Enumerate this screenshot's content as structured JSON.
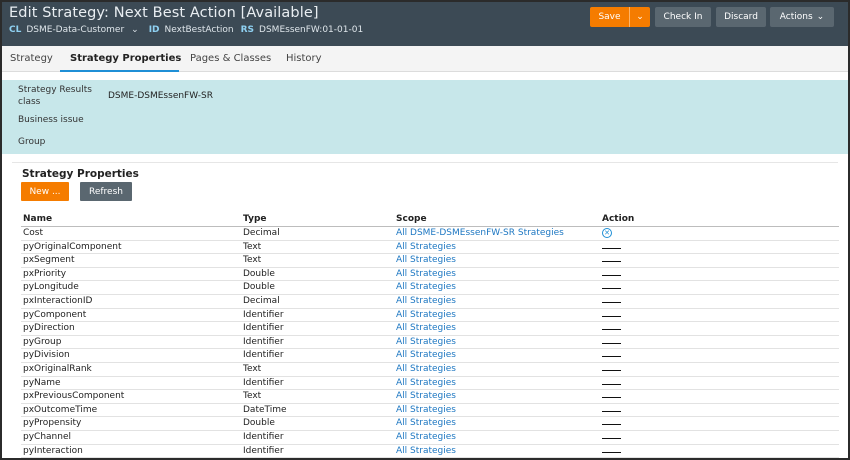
{
  "header": {
    "title": "Edit Strategy: Next Best Action [Available]",
    "cl_key": "CL",
    "cl_value": "DSME-Data-Customer",
    "id_key": "ID",
    "id_value": "NextBestAction",
    "rs_key": "RS",
    "rs_value": "DSMEssenFW:01-01-01",
    "save_label": "Save",
    "checkin_label": "Check In",
    "discard_label": "Discard",
    "actions_label": "Actions"
  },
  "tabs": [
    {
      "label": "Strategy"
    },
    {
      "label": "Strategy Properties"
    },
    {
      "label": "Pages & Classes"
    },
    {
      "label": "History"
    }
  ],
  "info": {
    "results_class_label_1": "Strategy Results",
    "results_class_label_2": "class",
    "results_class_value": "DSME-DSMEssenFW-SR",
    "business_issue_label": "Business issue",
    "group_label": "Group"
  },
  "section": {
    "title": "Strategy Properties",
    "new_label": "New ...",
    "refresh_label": "Refresh"
  },
  "table": {
    "columns": [
      "Name",
      "Type",
      "Scope",
      "Action"
    ],
    "rows": [
      {
        "name": "Cost",
        "type": "Decimal",
        "scope": "All DSME-DSMEssenFW-SR Strategies",
        "action": "remove"
      },
      {
        "name": "pyOriginalComponent",
        "type": "Text",
        "scope": "All Strategies",
        "action": "none"
      },
      {
        "name": "pxSegment",
        "type": "Text",
        "scope": "All Strategies",
        "action": "none"
      },
      {
        "name": "pxPriority",
        "type": "Double",
        "scope": "All Strategies",
        "action": "none"
      },
      {
        "name": "pyLongitude",
        "type": "Double",
        "scope": "All Strategies",
        "action": "none"
      },
      {
        "name": "pxInteractionID",
        "type": "Decimal",
        "scope": "All Strategies",
        "action": "none"
      },
      {
        "name": "pyComponent",
        "type": "Identifier",
        "scope": "All Strategies",
        "action": "none"
      },
      {
        "name": "pyDirection",
        "type": "Identifier",
        "scope": "All Strategies",
        "action": "none"
      },
      {
        "name": "pyGroup",
        "type": "Identifier",
        "scope": "All Strategies",
        "action": "none"
      },
      {
        "name": "pyDivision",
        "type": "Identifier",
        "scope": "All Strategies",
        "action": "none"
      },
      {
        "name": "pxOriginalRank",
        "type": "Text",
        "scope": "All Strategies",
        "action": "none"
      },
      {
        "name": "pyName",
        "type": "Identifier",
        "scope": "All Strategies",
        "action": "none"
      },
      {
        "name": "pxPreviousComponent",
        "type": "Text",
        "scope": "All Strategies",
        "action": "none"
      },
      {
        "name": "pxOutcomeTime",
        "type": "DateTime",
        "scope": "All Strategies",
        "action": "none"
      },
      {
        "name": "pyPropensity",
        "type": "Double",
        "scope": "All Strategies",
        "action": "none"
      },
      {
        "name": "pyChannel",
        "type": "Identifier",
        "scope": "All Strategies",
        "action": "none"
      },
      {
        "name": "pyInteraction",
        "type": "Identifier",
        "scope": "All Strategies",
        "action": "none"
      }
    ]
  },
  "colors": {
    "header_bg": "#3c4a55",
    "accent_orange": "#f57c00",
    "secondary_button": "#5a6770",
    "info_panel_bg": "#c7e7ea",
    "link_blue": "#1d77c2",
    "tab_underline": "#1f8fd6"
  }
}
